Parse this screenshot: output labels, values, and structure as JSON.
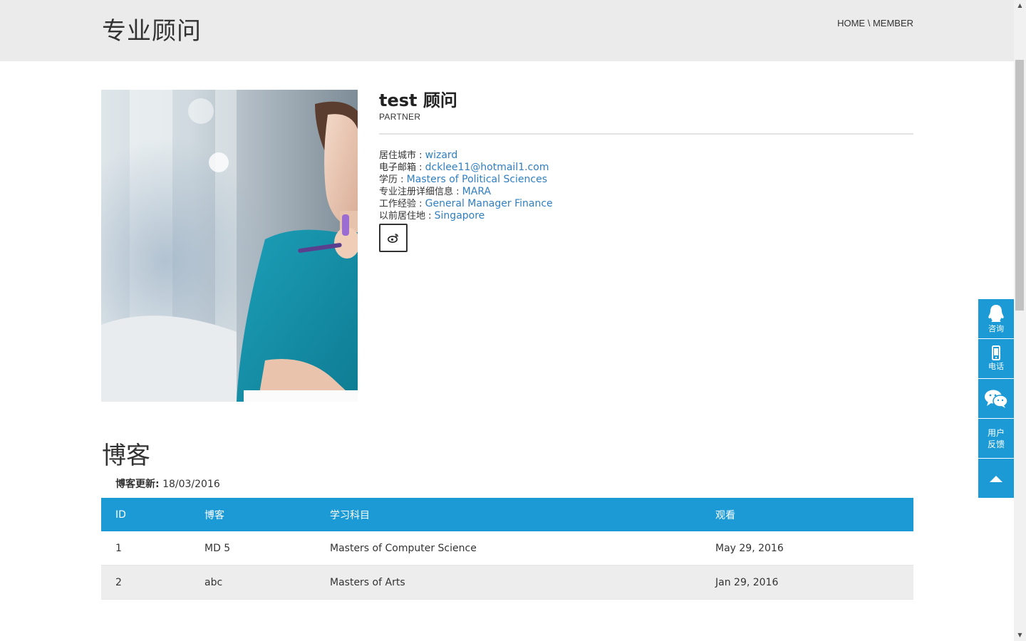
{
  "header": {
    "title": "专业顾问",
    "breadcrumb": {
      "home": "HOME",
      "separator": " \\ ",
      "current": "MEMBER"
    }
  },
  "profile": {
    "name": "test 顾问",
    "role": "PARTNER",
    "details": [
      {
        "label": "居住城市 : ",
        "value": "wizard"
      },
      {
        "label": "电子邮箱 : ",
        "value": "dcklee11@hotmail1.com"
      },
      {
        "label": "学历 : ",
        "value": "Masters of Political Sciences"
      },
      {
        "label": "专业注册详细信息 : ",
        "value": "MARA"
      },
      {
        "label": "工作经验 : ",
        "value": "General Manager Finance"
      },
      {
        "label": "以前居住地 : ",
        "value": "Singapore"
      }
    ],
    "social_icon": "weibo-icon"
  },
  "blog": {
    "title": "博客",
    "updated_label": "博客更新:",
    "updated_date": "18/03/2016",
    "columns": [
      "ID",
      "博客",
      "学习科目",
      "观看"
    ],
    "rows": [
      [
        "1",
        "MD 5",
        "Masters of Computer Science",
        "May 29, 2016"
      ],
      [
        "2",
        "abc",
        "Masters of Arts",
        "Jan 29, 2016"
      ]
    ]
  },
  "float_bar": {
    "items": [
      {
        "icon": "qq-icon",
        "label": "咨询"
      },
      {
        "icon": "phone-icon",
        "label": "电话"
      },
      {
        "icon": "wechat-icon",
        "label": ""
      },
      {
        "icon": "",
        "label": "用户\n反馈"
      },
      {
        "icon": "arrow-up-icon",
        "label": ""
      }
    ]
  },
  "colors": {
    "accent": "#1b9ad6",
    "link": "#2f7fc1",
    "header_bg": "#ebebeb",
    "alt_row": "#ededed"
  }
}
